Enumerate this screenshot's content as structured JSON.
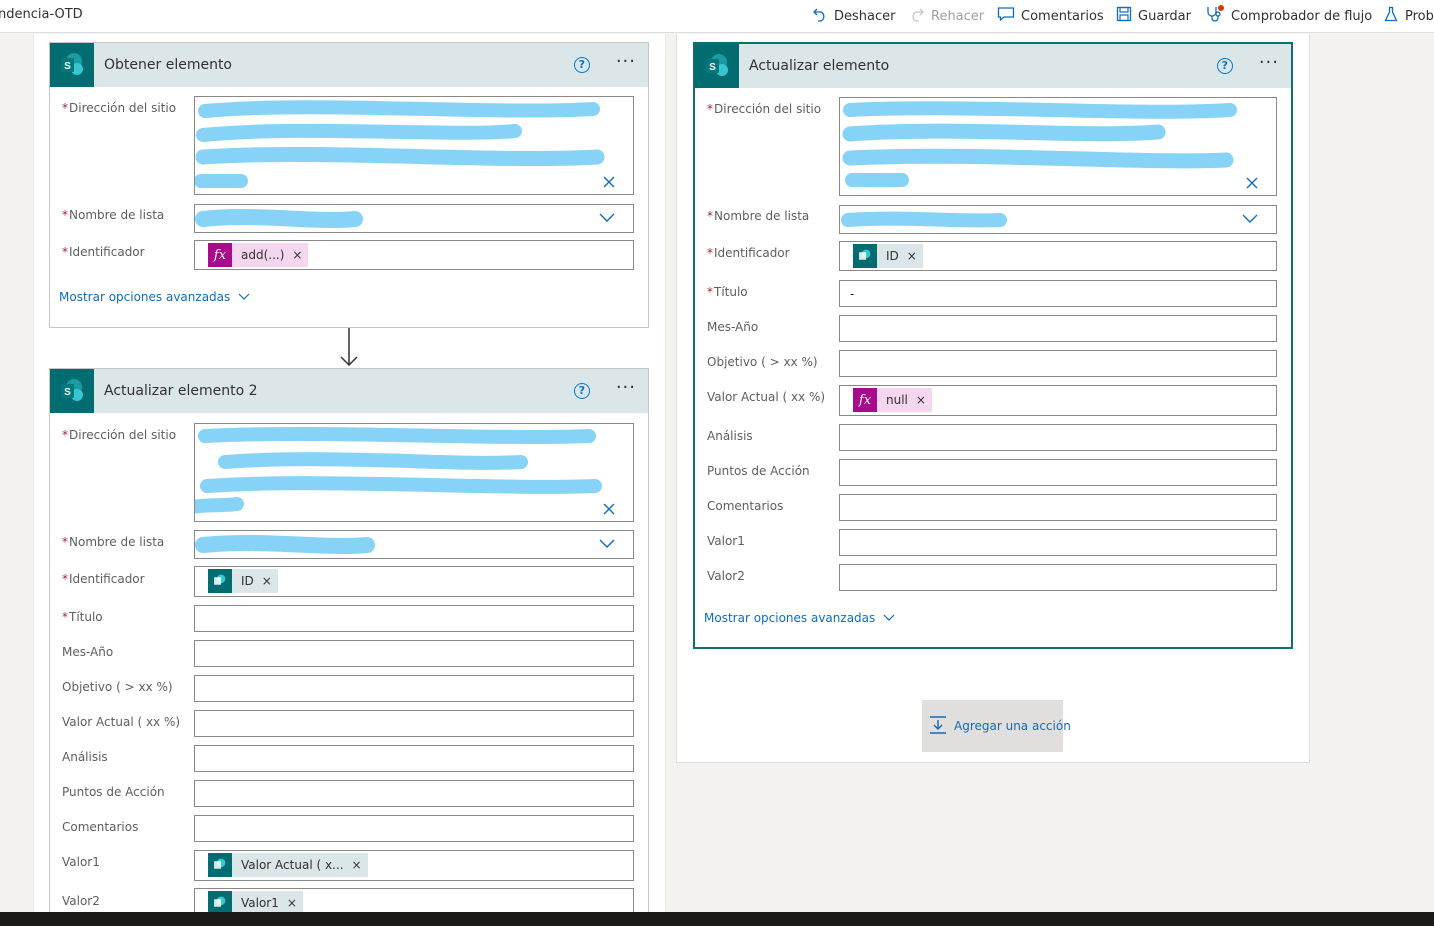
{
  "toolbar": {
    "flow_name": "ndencia-OTD",
    "undo": "Deshacer",
    "redo": "Rehacer",
    "comments": "Comentarios",
    "save": "Guardar",
    "checker": "Comprobador de flujo",
    "test": "Prob"
  },
  "card_get": {
    "title": "Obtener elemento",
    "site_label": "Dirección del sitio",
    "list_label": "Nombre de lista",
    "id_label": "Identificador",
    "id_token": "add(...)",
    "advanced": "Mostrar opciones avanzadas"
  },
  "card_update2": {
    "title": "Actualizar elemento 2",
    "site_label": "Dirección del sitio",
    "list_label": "Nombre de lista",
    "id_label": "Identificador",
    "id_token": "ID",
    "titulo_label": "Título",
    "mes_label": "Mes-Año",
    "objetivo_label": "Objetivo ( > xx %)",
    "valor_actual_label": "Valor Actual ( xx %)",
    "analisis_label": "Análisis",
    "puntos_label": "Puntos de Acción",
    "comentarios_label": "Comentarios",
    "valor1_label": "Valor1",
    "valor1_token": "Valor Actual ( x...",
    "valor2_label": "Valor2",
    "valor2_token": "Valor1"
  },
  "card_update": {
    "title": "Actualizar elemento",
    "site_label": "Dirección del sitio",
    "list_label": "Nombre de lista",
    "id_label": "Identificador",
    "id_token": "ID",
    "titulo_label": "Título",
    "titulo_value": "-",
    "mes_label": "Mes-Año",
    "objetivo_label": "Objetivo ( > xx %)",
    "valor_actual_label": "Valor Actual ( xx %)",
    "valor_actual_token": "null",
    "analisis_label": "Análisis",
    "puntos_label": "Puntos de Acción",
    "comentarios_label": "Comentarios",
    "valor1_label": "Valor1",
    "valor2_label": "Valor2",
    "advanced": "Mostrar opciones avanzadas"
  },
  "add_action": "Agregar una acción",
  "required_mark": "*",
  "help_glyph": "?",
  "more_glyph": "···",
  "token_remove": "×",
  "fx_glyph": "fx",
  "colors": {
    "sharepoint": "#036c70",
    "header_bg": "#dbe6e8",
    "expression_token": "#a80a8c",
    "link": "#0f6cbd",
    "redaction": "#86d3f7"
  },
  "icons": [
    "undo-icon",
    "redo-icon",
    "comment-icon",
    "save-icon",
    "stethoscope-icon",
    "flask-icon",
    "sharepoint-icon",
    "help-icon",
    "more-icon",
    "clear-icon",
    "chevron-down-icon",
    "arrow-down-icon",
    "add-action-icon"
  ]
}
